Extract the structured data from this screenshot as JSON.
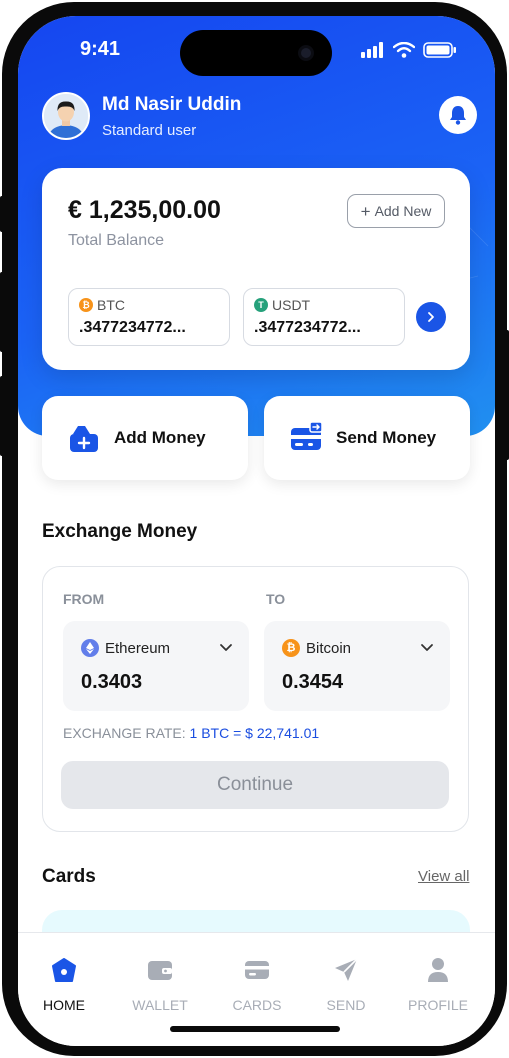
{
  "status": {
    "time": "9:41"
  },
  "user": {
    "name": "Md Nasir Uddin",
    "role": "Standard user"
  },
  "balance": {
    "amount": "€ 1,235,00.00",
    "label": "Total Balance",
    "add_new": "Add New",
    "coins": [
      {
        "symbol": "BTC",
        "value": ".3477234772...",
        "color": "#f7931a",
        "glyph": "₿"
      },
      {
        "symbol": "USDT",
        "value": ".3477234772...",
        "color": "#26a17b",
        "glyph": "T"
      }
    ]
  },
  "actions": {
    "add_money": "Add Money",
    "send_money": "Send Money"
  },
  "exchange": {
    "title": "Exchange Money",
    "from_label": "FROM",
    "to_label": "TO",
    "from": {
      "coin": "Ethereum",
      "value": "0.3403"
    },
    "to": {
      "coin": "Bitcoin",
      "value": "0.3454"
    },
    "rate_label": "EXCHANGE RATE:",
    "rate_value": "1 BTC = $ 22,741.01",
    "continue": "Continue"
  },
  "cards": {
    "title": "Cards",
    "view_all": "View all"
  },
  "nav": {
    "items": [
      {
        "label": "HOME",
        "icon": "home-icon",
        "active": true
      },
      {
        "label": "WALLET",
        "icon": "wallet-icon"
      },
      {
        "label": "CARDS",
        "icon": "card-icon"
      },
      {
        "label": "SEND",
        "icon": "send-icon"
      },
      {
        "label": "PROFILE",
        "icon": "profile-icon"
      }
    ]
  },
  "colors": {
    "primary": "#1a55e6",
    "accent_blue": "#1a4de0",
    "ethereum": "#627eea",
    "bitcoin": "#f7931a"
  }
}
